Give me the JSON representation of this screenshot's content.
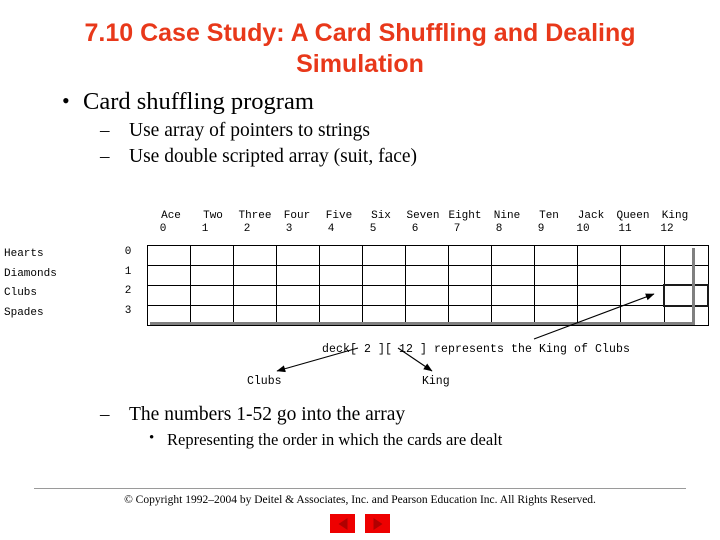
{
  "slide": {
    "title": "7.10  Case Study: A Card Shuffling and Dealing Simulation",
    "title_color": "#e8381a",
    "bullets": [
      {
        "level": 1,
        "marker": "•",
        "text": "Card shuffling program"
      },
      {
        "level": 2,
        "marker": "–",
        "text": "Use array of pointers to strings"
      },
      {
        "level": 2,
        "marker": "–",
        "text": "Use double scripted array (suit, face)"
      }
    ],
    "bullets_bottom": [
      {
        "level": 2,
        "marker": "–",
        "text": "The numbers 1-52 go into the array"
      },
      {
        "level": 3,
        "marker": "•",
        "text": "Representing the order in which the cards are dealt"
      }
    ]
  },
  "diagram": {
    "column_names": [
      "Ace",
      "Two",
      "Three",
      "Four",
      "Five",
      "Six",
      "Seven",
      "Eight",
      "Nine",
      "Ten",
      "Jack",
      "Queen",
      "King"
    ],
    "column_indices": [
      "0",
      "1",
      "2",
      "3",
      "4",
      "5",
      "6",
      "7",
      "8",
      "9",
      "10",
      "11",
      "12"
    ],
    "row_names": [
      "Hearts",
      "Diamonds",
      "Clubs",
      "Spades"
    ],
    "row_indices": [
      "0",
      "1",
      "2",
      "3"
    ],
    "highlight": {
      "row": 2,
      "col": 12
    },
    "caption": "deck[ 2 ][ 12 ] represents the King of Clubs",
    "callout_suit": "Clubs",
    "callout_face": "King"
  },
  "footer": {
    "copyright": "© Copyright 1992–2004 by Deitel & Associates, Inc. and Pearson Education Inc. All Rights Reserved.",
    "nav_prev_label": "previous-slide",
    "nav_next_label": "next-slide",
    "nav_color": "#ee0000"
  }
}
